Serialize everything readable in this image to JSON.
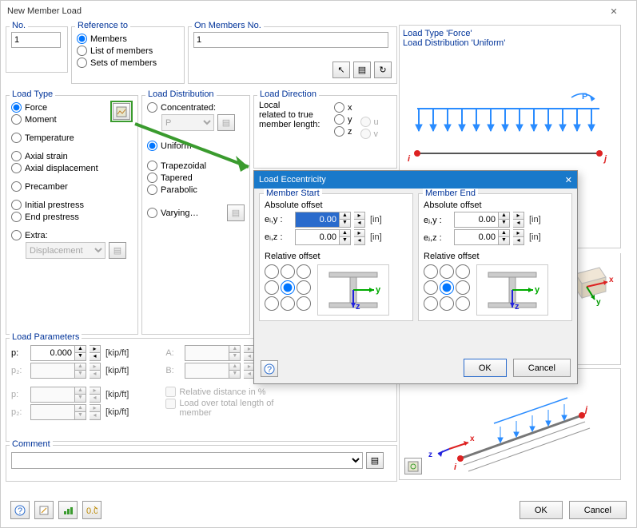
{
  "window": {
    "title": "New Member Load",
    "close": "✕"
  },
  "no_group": {
    "legend": "No.",
    "value": "1"
  },
  "reference": {
    "legend": "Reference to",
    "options": [
      "Members",
      "List of members",
      "Sets of members"
    ],
    "selected": 0
  },
  "on_members": {
    "legend": "On Members No.",
    "value": "1"
  },
  "load_type": {
    "legend": "Load Type",
    "options": [
      "Force",
      "Moment",
      "Temperature",
      "Axial strain",
      "Axial displacement",
      "Precamber",
      "Initial prestress",
      "End prestress",
      "Extra:"
    ],
    "selected": 0,
    "extra_combo": "Displacement"
  },
  "load_dist": {
    "legend": "Load Distribution",
    "options": [
      "Concentrated:",
      "Uniform",
      "Trapezoidal",
      "Tapered",
      "Parabolic",
      "Varying…"
    ],
    "selected": 1,
    "concentrated_combo": "P"
  },
  "load_dir": {
    "legend": "Load Direction",
    "local_label": "Local\nrelated to true\nmember length:",
    "axes": [
      "x",
      "y",
      "z"
    ],
    "aux": [
      "u",
      "v"
    ]
  },
  "preview": {
    "line1": "Load Type 'Force'",
    "line2": "Load Distribution 'Uniform'",
    "p_label": "P",
    "node_i": "i",
    "node_j": "j"
  },
  "load_params": {
    "legend": "Load Parameters",
    "rows": [
      {
        "label": "p:",
        "value": "0.000",
        "unit": "[kip/ft]"
      },
      {
        "label": "p₂:",
        "value": "",
        "unit": "[kip/ft]"
      },
      {
        "label": "p:",
        "value": "",
        "unit": "[kip/ft]"
      },
      {
        "label": "p₂:",
        "value": "",
        "unit": "[kip/ft]"
      }
    ],
    "side_labels": [
      "A:",
      "B:"
    ],
    "check1": "Relative distance in %",
    "check2": "Load over total length of member"
  },
  "comment": {
    "legend": "Comment",
    "value": ""
  },
  "popup": {
    "title": "Load Eccentricity",
    "start": {
      "legend": "Member Start",
      "abs_label": "Absolute offset",
      "y_label": "eᵢ,y :",
      "y_value": "0.00",
      "y_unit": "[in]",
      "z_label": "eᵢ,z :",
      "z_value": "0.00",
      "z_unit": "[in]",
      "rel_label": "Relative offset"
    },
    "end": {
      "legend": "Member End",
      "abs_label": "Absolute offset",
      "y_label": "eⱼ,y :",
      "y_value": "0.00",
      "y_unit": "[in]",
      "z_label": "eⱼ,z :",
      "z_value": "0.00",
      "z_unit": "[in]",
      "rel_label": "Relative offset"
    },
    "ok": "OK",
    "cancel": "Cancel"
  },
  "buttons": {
    "ok": "OK",
    "cancel": "Cancel"
  },
  "footer_icons": [
    "help",
    "edit",
    "chart",
    "units"
  ],
  "axis_labels": {
    "x": "x",
    "y": "y",
    "z": "z",
    "i": "i",
    "j": "j"
  }
}
